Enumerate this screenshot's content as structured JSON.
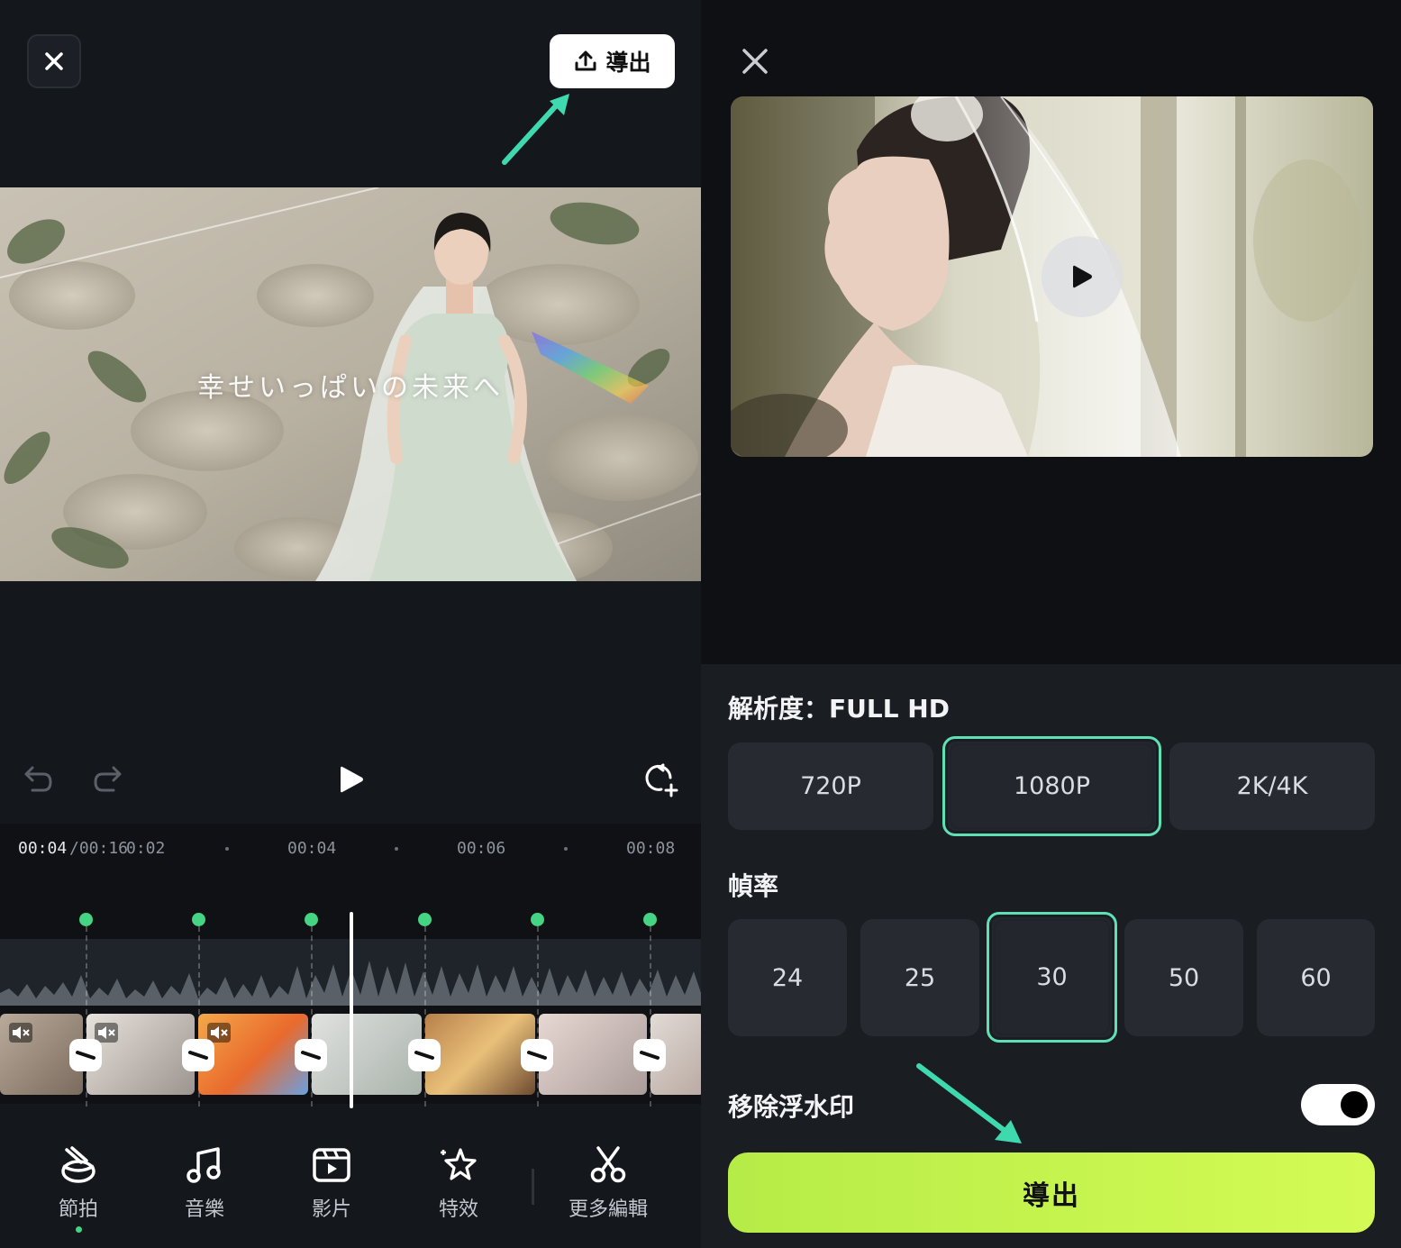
{
  "left": {
    "export_label": "導出",
    "overlay_text": "幸せいっぱいの未来へ",
    "timeline": {
      "current": "00:04",
      "total": "/00:16",
      "ticks": [
        "0:02",
        "00:04",
        "00:06",
        "00:08"
      ]
    },
    "nav": [
      {
        "label": "節拍",
        "icon": "beat-icon",
        "active": true
      },
      {
        "label": "音樂",
        "icon": "music-note-icon"
      },
      {
        "label": "影片",
        "icon": "video-clip-icon"
      },
      {
        "label": "特效",
        "icon": "effects-star-icon"
      },
      {
        "label": "更多編輯",
        "icon": "scissors-icon"
      }
    ]
  },
  "right": {
    "resolution_title": "解析度：FULL HD",
    "resolutions": [
      "720P",
      "1080P",
      "2K/4K"
    ],
    "resolution_selected": "1080P",
    "framerate_title": "幀率",
    "framerates": [
      "24",
      "25",
      "30",
      "50",
      "60"
    ],
    "framerate_selected": "30",
    "watermark_label": "移除浮水印",
    "watermark_toggle_on": true,
    "export_label": "導出"
  },
  "colors": {
    "accent_green": "#45d483",
    "selected_border": "#5ee0b4",
    "export_button": "#c8f64f",
    "annotation_arrow": "#3fd9b0"
  }
}
